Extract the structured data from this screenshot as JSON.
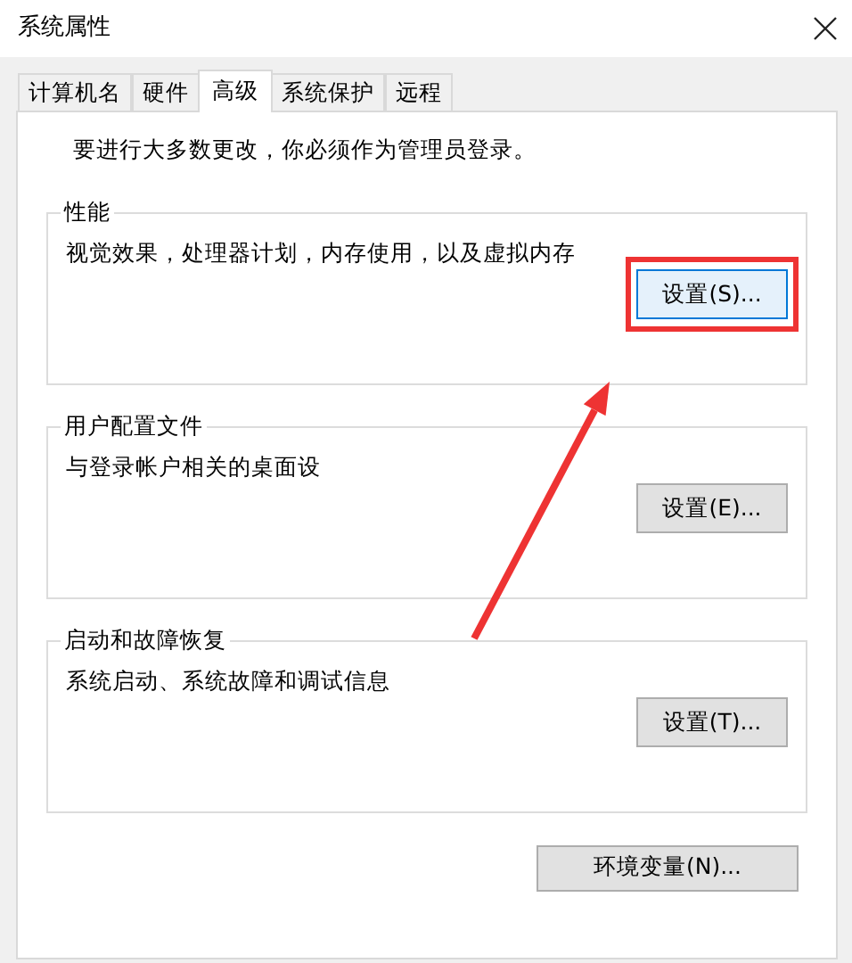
{
  "window": {
    "title": "系统属性"
  },
  "tabs": [
    {
      "label": "计算机名",
      "selected": false
    },
    {
      "label": "硬件",
      "selected": false
    },
    {
      "label": "高级",
      "selected": true
    },
    {
      "label": "系统保护",
      "selected": false
    },
    {
      "label": "远程",
      "selected": false
    }
  ],
  "notice": "要进行大多数更改，你必须作为管理员登录。",
  "groups": [
    {
      "title": "性能",
      "description": "视觉效果，处理器计划，内存使用，以及虚拟内存",
      "button": {
        "label": "设置(S)...",
        "focused": true,
        "highlighted": true
      }
    },
    {
      "title": "用户配置文件",
      "description": "与登录帐户相关的桌面设",
      "button": {
        "label": "设置(E)...",
        "focused": false,
        "highlighted": false
      }
    },
    {
      "title": "启动和故障恢复",
      "description": "系统启动、系统故障和调试信息",
      "button": {
        "label": "设置(T)...",
        "focused": false,
        "highlighted": false
      }
    }
  ],
  "env_button": {
    "label": "环境变量(N)..."
  }
}
